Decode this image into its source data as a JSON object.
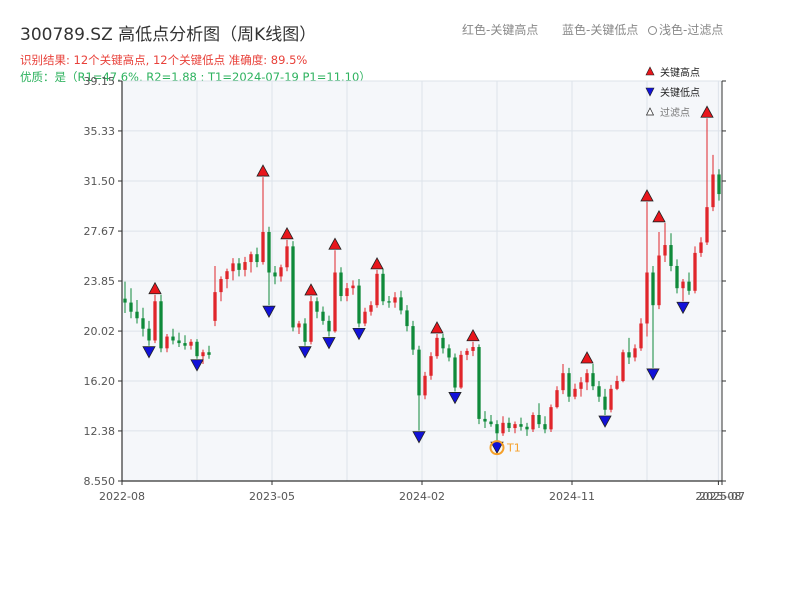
{
  "header": {
    "title": "300789.SZ 高低点分析图（周K线图）",
    "subtitle1": "识别结果: 12个关键高点, 12个关键低点  准确度: 89.5%",
    "subtitle2": "优质：是（R1=47.6%, R2=1.88 ; T1=2024-07-19 P1=11.10）"
  },
  "top_legend": {
    "red": "红色-关键高点",
    "blue": "蓝色-关键低点",
    "light": "浅色-过滤点"
  },
  "colors": {
    "up": "#e0262b",
    "down": "#0f8a3a",
    "high_marker": "#e8161c",
    "low_marker": "#1212d8",
    "t1_marker": "#f5a02a",
    "grid": "#dde3ea",
    "plot_bg": "#f5f7fa"
  },
  "chart_data": {
    "type": "candlestick",
    "title": "300789.SZ 高低点分析图（周K线图）",
    "y_ticks": [
      "39.15",
      "35.33",
      "31.50",
      "27.67",
      "23.85",
      "20.02",
      "16.20",
      "12.38",
      "8.550"
    ],
    "ylim": [
      8.55,
      39.15
    ],
    "x_ticks": [
      "2022-08",
      "2023-05",
      "2024-02",
      "2024-11",
      "2025-08",
      "2025-07"
    ],
    "x_tick_positions": [
      0,
      0.25,
      0.5,
      0.75,
      0.994,
      1.0
    ],
    "grid": true,
    "legend": {
      "position": "top-right",
      "items": [
        {
          "label": "关键高点",
          "icon": "red-up-triangle-icon"
        },
        {
          "label": "关键低点",
          "icon": "blue-down-triangle-icon"
        },
        {
          "label": "过滤点",
          "icon": "hollow-triangle-icon"
        }
      ]
    },
    "candles": [
      [
        22.5,
        23.8,
        21.4,
        22.2
      ],
      [
        22.2,
        23.3,
        21.0,
        21.5
      ],
      [
        21.5,
        22.4,
        20.6,
        21.0
      ],
      [
        21.0,
        21.8,
        19.6,
        20.2
      ],
      [
        20.2,
        20.8,
        18.9,
        19.3
      ],
      [
        19.3,
        22.8,
        19.1,
        22.3
      ],
      [
        22.3,
        22.8,
        18.4,
        18.7
      ],
      [
        18.7,
        19.8,
        18.4,
        19.6
      ],
      [
        19.6,
        20.2,
        19.0,
        19.3
      ],
      [
        19.3,
        19.9,
        18.8,
        19.1
      ],
      [
        19.1,
        19.7,
        18.6,
        18.9
      ],
      [
        18.9,
        19.4,
        18.6,
        19.2
      ],
      [
        19.2,
        19.4,
        17.9,
        18.1
      ],
      [
        18.1,
        18.6,
        17.5,
        18.4
      ],
      [
        18.4,
        18.9,
        17.9,
        18.2
      ],
      [
        20.8,
        25.0,
        20.4,
        23.0
      ],
      [
        23.0,
        24.2,
        22.3,
        24.0
      ],
      [
        24.0,
        24.8,
        23.3,
        24.6
      ],
      [
        24.6,
        25.6,
        23.9,
        25.2
      ],
      [
        25.2,
        25.6,
        24.2,
        24.7
      ],
      [
        24.7,
        25.7,
        24.2,
        25.3
      ],
      [
        25.3,
        26.1,
        24.5,
        25.9
      ],
      [
        25.9,
        26.4,
        24.9,
        25.3
      ],
      [
        25.3,
        31.8,
        25.1,
        27.6
      ],
      [
        27.6,
        28.0,
        22.0,
        24.5
      ],
      [
        24.5,
        25.0,
        23.6,
        24.2
      ],
      [
        24.2,
        25.1,
        23.8,
        24.9
      ],
      [
        24.9,
        27.0,
        24.6,
        26.5
      ],
      [
        26.5,
        26.9,
        20.0,
        20.3
      ],
      [
        20.3,
        20.8,
        19.8,
        20.6
      ],
      [
        20.6,
        21.0,
        18.9,
        19.2
      ],
      [
        19.2,
        22.7,
        19.0,
        22.3
      ],
      [
        22.3,
        22.6,
        21.0,
        21.5
      ],
      [
        21.5,
        21.9,
        20.5,
        20.8
      ],
      [
        20.8,
        21.2,
        19.6,
        20.0
      ],
      [
        20.0,
        26.2,
        19.9,
        24.5
      ],
      [
        24.5,
        24.9,
        22.3,
        22.7
      ],
      [
        22.7,
        23.7,
        22.3,
        23.3
      ],
      [
        23.3,
        23.9,
        22.8,
        23.5
      ],
      [
        23.5,
        24.0,
        20.3,
        20.6
      ],
      [
        20.6,
        21.8,
        20.4,
        21.5
      ],
      [
        21.5,
        22.3,
        21.2,
        22.0
      ],
      [
        22.0,
        24.7,
        21.8,
        24.4
      ],
      [
        24.4,
        24.8,
        22.0,
        22.3
      ],
      [
        22.3,
        22.7,
        21.8,
        22.2
      ],
      [
        22.2,
        23.0,
        21.8,
        22.6
      ],
      [
        22.6,
        23.1,
        21.3,
        21.6
      ],
      [
        21.6,
        22.0,
        20.0,
        20.4
      ],
      [
        20.4,
        20.8,
        18.2,
        18.6
      ],
      [
        18.6,
        18.9,
        12.4,
        15.1
      ],
      [
        15.1,
        16.9,
        14.8,
        16.6
      ],
      [
        16.6,
        18.4,
        16.3,
        18.1
      ],
      [
        18.1,
        19.8,
        17.9,
        19.5
      ],
      [
        19.5,
        19.8,
        18.3,
        18.7
      ],
      [
        18.7,
        19.0,
        17.7,
        18.0
      ],
      [
        18.0,
        18.3,
        15.4,
        15.7
      ],
      [
        15.7,
        18.5,
        15.6,
        18.2
      ],
      [
        18.2,
        18.7,
        17.8,
        18.5
      ],
      [
        18.5,
        19.2,
        18.1,
        18.8
      ],
      [
        18.8,
        19.0,
        12.9,
        13.3
      ],
      [
        13.3,
        13.9,
        12.6,
        13.1
      ],
      [
        13.1,
        13.6,
        12.7,
        12.9
      ],
      [
        12.9,
        13.2,
        11.6,
        12.2
      ],
      [
        12.2,
        13.5,
        12.0,
        13.0
      ],
      [
        13.0,
        13.4,
        12.3,
        12.6
      ],
      [
        12.6,
        13.1,
        12.2,
        12.9
      ],
      [
        12.9,
        13.4,
        12.4,
        12.7
      ],
      [
        12.7,
        13.0,
        12.0,
        12.5
      ],
      [
        12.5,
        13.8,
        12.3,
        13.6
      ],
      [
        13.6,
        14.5,
        12.6,
        12.9
      ],
      [
        12.9,
        13.5,
        12.2,
        12.5
      ],
      [
        12.5,
        14.4,
        12.3,
        14.2
      ],
      [
        14.2,
        15.8,
        14.1,
        15.5
      ],
      [
        15.5,
        17.5,
        15.2,
        16.8
      ],
      [
        16.8,
        17.2,
        14.6,
        15.0
      ],
      [
        15.0,
        16.0,
        14.8,
        15.6
      ],
      [
        15.6,
        16.5,
        15.0,
        16.1
      ],
      [
        16.1,
        17.1,
        15.5,
        16.8
      ],
      [
        16.8,
        17.5,
        15.5,
        15.8
      ],
      [
        15.8,
        16.2,
        14.6,
        15.0
      ],
      [
        15.0,
        15.6,
        13.6,
        14.0
      ],
      [
        14.0,
        15.9,
        13.8,
        15.6
      ],
      [
        15.6,
        16.6,
        15.5,
        16.2
      ],
      [
        16.2,
        18.6,
        16.1,
        18.4
      ],
      [
        18.4,
        19.5,
        17.5,
        18.0
      ],
      [
        18.0,
        19.0,
        17.7,
        18.7
      ],
      [
        18.7,
        21.0,
        18.5,
        20.6
      ],
      [
        20.6,
        29.9,
        19.6,
        24.5
      ],
      [
        24.5,
        25.0,
        17.2,
        22.0
      ],
      [
        22.0,
        27.6,
        21.7,
        25.8
      ],
      [
        25.8,
        28.3,
        25.3,
        26.6
      ],
      [
        26.6,
        27.5,
        24.6,
        25.0
      ],
      [
        25.0,
        25.5,
        22.9,
        23.3
      ],
      [
        23.3,
        24.0,
        22.3,
        23.8
      ],
      [
        23.8,
        24.5,
        22.8,
        23.1
      ],
      [
        23.1,
        26.5,
        22.9,
        26.0
      ],
      [
        26.0,
        27.2,
        25.7,
        26.8
      ],
      [
        26.8,
        36.3,
        26.6,
        29.5
      ],
      [
        29.5,
        33.5,
        29.2,
        32.0
      ],
      [
        32.0,
        32.4,
        30.0,
        30.5
      ]
    ],
    "key_highs": [
      {
        "i": 5,
        "price": 22.8
      },
      {
        "i": 23,
        "price": 31.8
      },
      {
        "i": 27,
        "price": 27.0
      },
      {
        "i": 31,
        "price": 22.7
      },
      {
        "i": 35,
        "price": 26.2
      },
      {
        "i": 42,
        "price": 24.7
      },
      {
        "i": 52,
        "price": 19.8
      },
      {
        "i": 58,
        "price": 19.2
      },
      {
        "i": 77,
        "price": 17.5
      },
      {
        "i": 87,
        "price": 29.9
      },
      {
        "i": 89,
        "price": 28.3
      },
      {
        "i": 97,
        "price": 36.3
      }
    ],
    "key_lows": [
      {
        "i": 4,
        "price": 18.9
      },
      {
        "i": 12,
        "price": 17.9
      },
      {
        "i": 24,
        "price": 22.0
      },
      {
        "i": 30,
        "price": 18.9
      },
      {
        "i": 34,
        "price": 19.6
      },
      {
        "i": 39,
        "price": 20.3
      },
      {
        "i": 49,
        "price": 12.4
      },
      {
        "i": 55,
        "price": 15.4
      },
      {
        "i": 62,
        "price": 11.6
      },
      {
        "i": 80,
        "price": 13.6
      },
      {
        "i": 88,
        "price": 17.2
      },
      {
        "i": 93,
        "price": 22.3
      }
    ],
    "t1": {
      "i": 62,
      "price": 11.1,
      "label": "T1"
    }
  }
}
